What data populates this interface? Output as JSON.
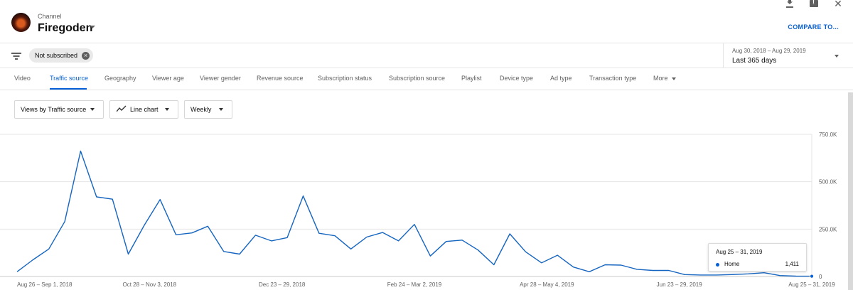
{
  "header": {
    "channel_caption": "Channel",
    "channel_name": "Firegoden",
    "compare_label": "COMPARE TO..."
  },
  "icons": {
    "download": "download-icon",
    "feedback": "feedback-icon",
    "close": "close-icon",
    "filter": "filter-icon",
    "line_chart": "line-chart-icon"
  },
  "filter": {
    "chip_label": "Not subscribed",
    "date_range": "Aug 30, 2018 – Aug 29, 2019",
    "date_label": "Last 365 days"
  },
  "tabs": [
    {
      "label": "Video"
    },
    {
      "label": "Traffic source",
      "active": true
    },
    {
      "label": "Geography"
    },
    {
      "label": "Viewer age"
    },
    {
      "label": "Viewer gender"
    },
    {
      "label": "Revenue source"
    },
    {
      "label": "Subscription status"
    },
    {
      "label": "Subscription source"
    },
    {
      "label": "Playlist"
    },
    {
      "label": "Device type"
    },
    {
      "label": "Ad type"
    },
    {
      "label": "Transaction type"
    },
    {
      "label": "More"
    }
  ],
  "controls": {
    "metric": "Views by Traffic source",
    "chart_type": "Line chart",
    "period": "Weekly"
  },
  "colors": {
    "accent": "#065fd4",
    "line": "#1565c0",
    "grid": "#e5e5e5",
    "muted_text": "#606060"
  },
  "chart_data": {
    "type": "line",
    "x_tick_labels": [
      "Aug 26 – Sep 1, 2018",
      "Oct 28 – Nov 3, 2018",
      "Dec 23 – 29, 2018",
      "Feb 24 – Mar 2, 2019",
      "Apr 28 – May 4, 2019",
      "Jun 23 – 29, 2019",
      "Aug 25 – 31, 2019"
    ],
    "y_tick_labels": [
      "750.0K",
      "500.0K",
      "250.0K",
      "0"
    ],
    "ylim": [
      0,
      750000
    ],
    "grid": true,
    "series": [
      {
        "name": "Home",
        "values": [
          25000,
          88000,
          145000,
          290000,
          662000,
          420000,
          408000,
          118000,
          270000,
          406000,
          220000,
          230000,
          265000,
          132000,
          118000,
          218000,
          188000,
          205000,
          425000,
          228000,
          215000,
          145000,
          208000,
          232000,
          188000,
          275000,
          108000,
          185000,
          192000,
          140000,
          62000,
          225000,
          130000,
          72000,
          112000,
          50000,
          25000,
          62000,
          60000,
          38000,
          32000,
          32000,
          10000,
          8000,
          8000,
          10000,
          14000,
          20000,
          5000,
          2000,
          1411
        ]
      }
    ]
  },
  "tooltip": {
    "date": "Aug 25 – 31, 2019",
    "series": "Home",
    "value": "1,411"
  }
}
